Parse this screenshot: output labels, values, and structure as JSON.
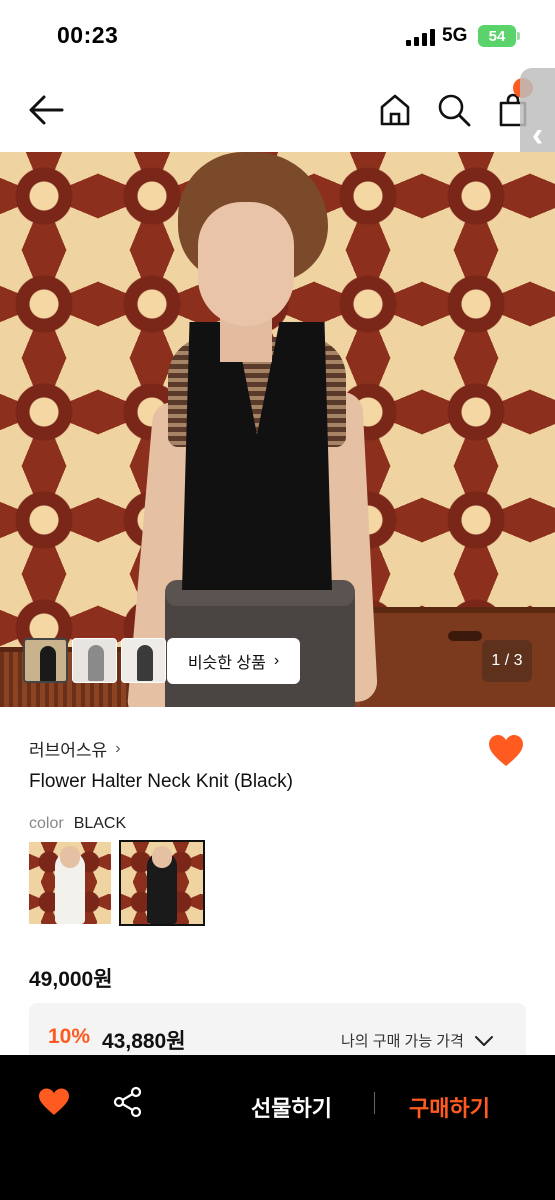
{
  "status_bar": {
    "time": "00:23",
    "network": "5G",
    "battery": "54"
  },
  "nav": {
    "back_icon": "arrow-left-icon",
    "home_icon": "home-icon",
    "search_icon": "search-icon",
    "bag_icon": "shopping-bag-icon"
  },
  "gallery": {
    "similar_button": "비슷한 상품",
    "counter": "1 / 3"
  },
  "product": {
    "brand": "러브어스유",
    "name": "Flower Halter Neck Knit (Black)",
    "color_label": "color",
    "color_value": "BLACK",
    "price": "49,000원",
    "discount_rate": "10%",
    "discount_price": "43,880원",
    "my_price_label": "나의 구매 가능 가격"
  },
  "bottom_bar": {
    "gift_label": "선물하기",
    "buy_label": "구매하기"
  },
  "colors": {
    "accent": "#ff5a1f",
    "battery": "#5bd36b"
  }
}
